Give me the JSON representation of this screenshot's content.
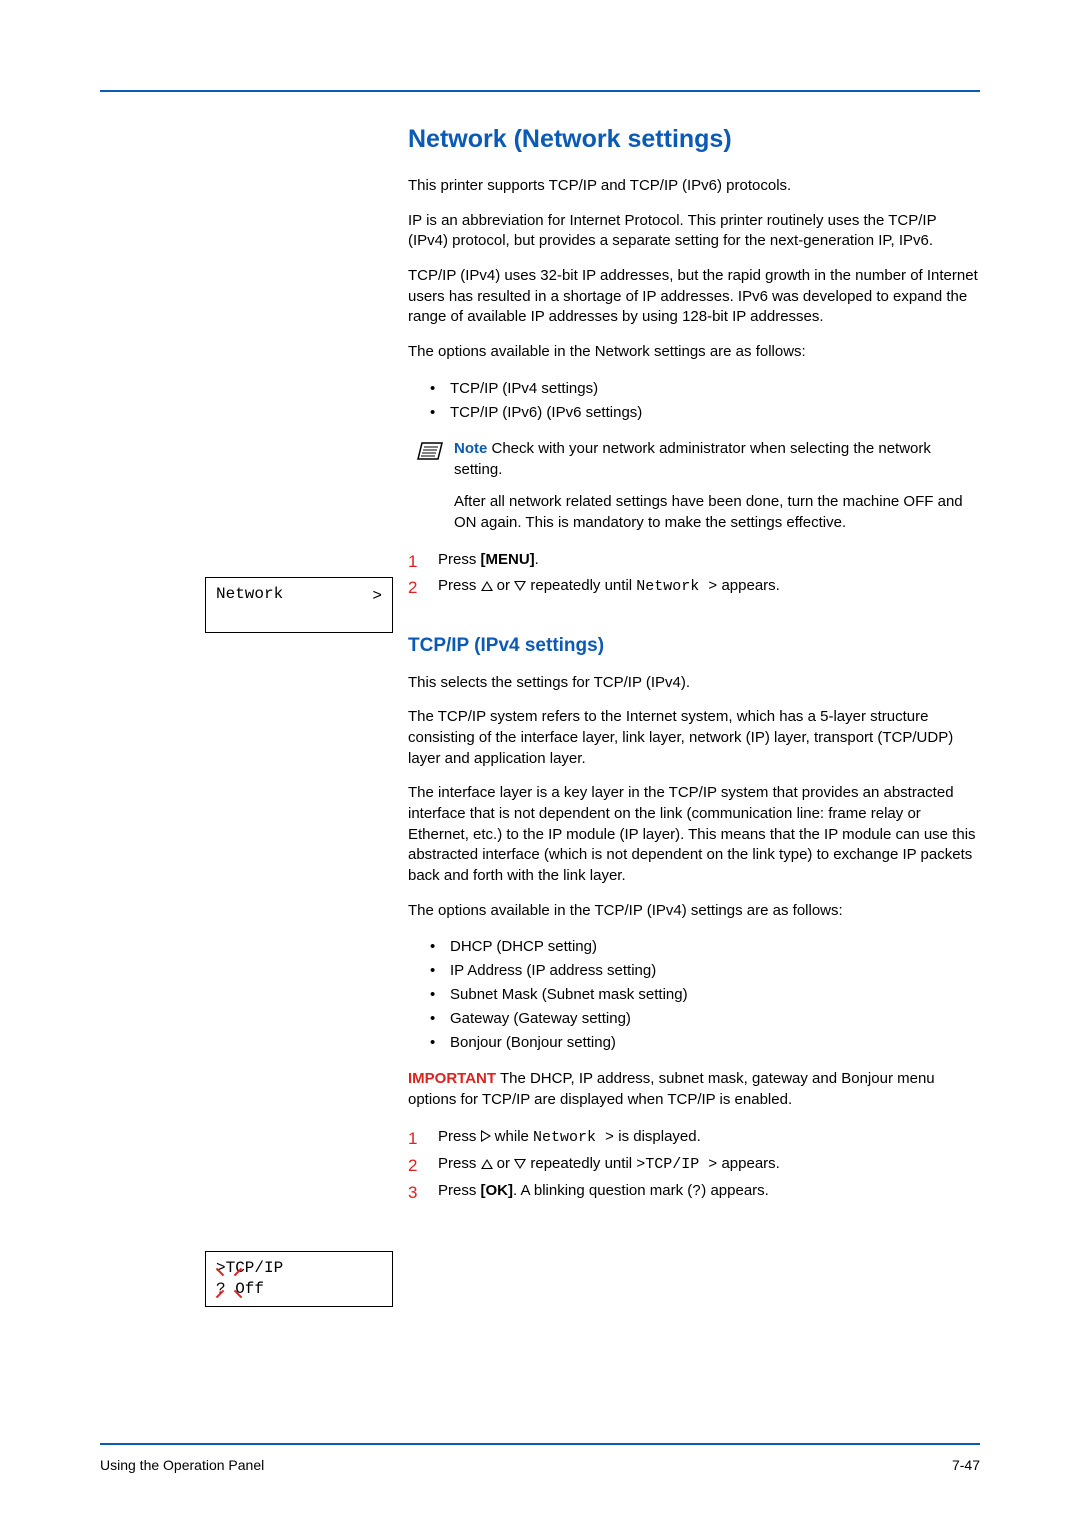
{
  "heading": "Network (Network settings)",
  "intro": {
    "p1": "This printer supports TCP/IP and TCP/IP (IPv6) protocols.",
    "p2": "IP is an abbreviation for Internet Protocol. This printer routinely uses the TCP/IP (IPv4) protocol, but provides a separate setting for the next-generation IP, IPv6.",
    "p3": "TCP/IP (IPv4) uses 32-bit IP addresses, but the rapid growth in the number of Internet users has resulted in a shortage of IP addresses. IPv6 was developed to expand the range of available IP addresses by using 128-bit IP addresses.",
    "p4": "The options available in the Network settings are as follows:"
  },
  "options1": [
    "TCP/IP (IPv4 settings)",
    "TCP/IP (IPv6) (IPv6 settings)"
  ],
  "note": {
    "label": "Note",
    "text": "  Check with your network administrator when selecting the network setting.",
    "after": "After all network related settings have been done, turn the machine OFF and ON again. This is mandatory to make the settings effective."
  },
  "steps1": {
    "s1_pre": "Press ",
    "s1_bold": "[MENU]",
    "s1_post": ".",
    "s2_pre": "Press ",
    "s2_mid": " or ",
    "s2_post1": " repeatedly until ",
    "s2_mono": "Network >",
    "s2_post2": " appears."
  },
  "display1": {
    "text": "Network",
    "arrow": ">"
  },
  "section2": {
    "heading": "TCP/IP (IPv4 settings)",
    "p1": "This selects the settings for TCP/IP (IPv4).",
    "p2": "The TCP/IP system refers to the Internet system, which has a 5-layer structure consisting of the interface layer, link layer, network (IP) layer, transport (TCP/UDP) layer and application layer.",
    "p3": "The interface layer is a key layer in the TCP/IP system that provides an abstracted interface that is not dependent on the link (communication line: frame relay or Ethernet, etc.) to the IP module (IP layer). This means that the IP module can use this abstracted interface (which is not dependent on the link type) to exchange IP packets back and forth with the link layer.",
    "p4": "The options available in the TCP/IP (IPv4) settings are as follows:"
  },
  "options2": [
    "DHCP (DHCP setting)",
    "IP Address (IP address setting)",
    "Subnet Mask (Subnet mask setting)",
    "Gateway (Gateway setting)",
    "Bonjour (Bonjour setting)"
  ],
  "important": {
    "label": "IMPORTANT",
    "text": "  The DHCP, IP address, subnet mask, gateway and Bonjour menu options for TCP/IP are displayed when TCP/IP is enabled."
  },
  "steps2": {
    "s1_pre": "Press ",
    "s1_mid": " while ",
    "s1_mono": "Network >",
    "s1_post": " is displayed.",
    "s2_pre": "Press ",
    "s2_mid": " or ",
    "s2_post1": " repeatedly until ",
    "s2_mono": ">TCP/IP >",
    "s2_post2": " appears.",
    "s3_pre": "Press ",
    "s3_bold": "[OK]",
    "s3_post1": ". A blinking question mark (",
    "s3_mono": "?",
    "s3_post2": ") appears."
  },
  "display2": {
    "line1": ">TCP/IP",
    "line2": "? Off"
  },
  "footer": {
    "left": "Using the Operation Panel",
    "right": "7-47"
  }
}
